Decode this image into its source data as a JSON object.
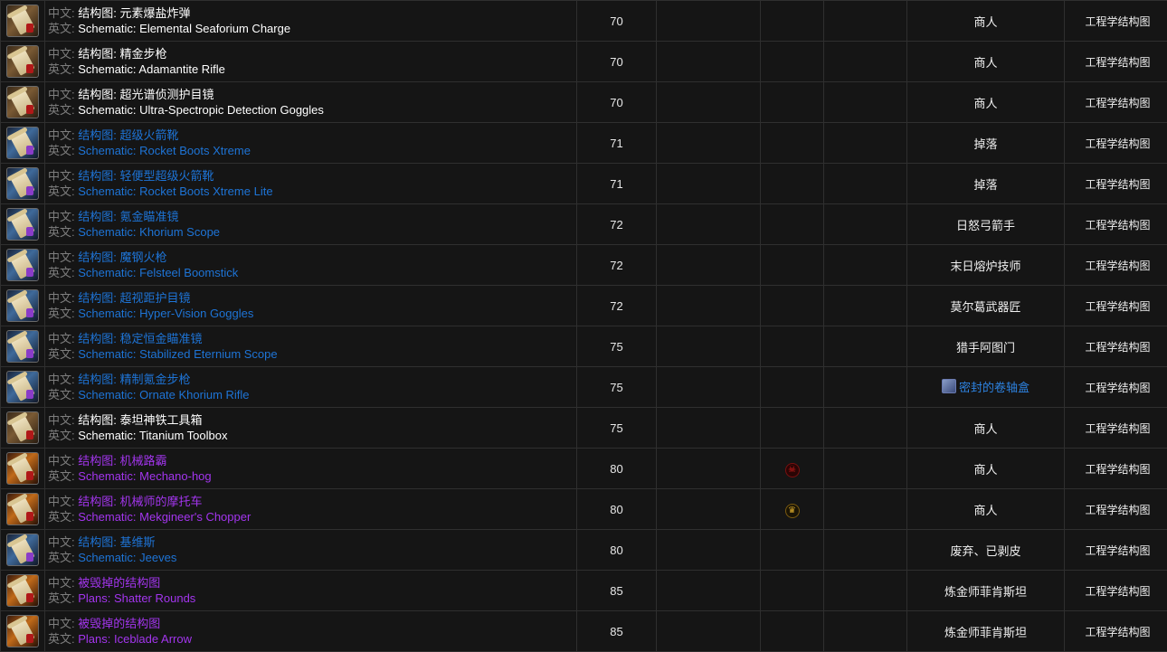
{
  "labels": {
    "zh": "中文: ",
    "en": "英文: "
  },
  "rows": [
    {
      "zh": "结构图: 元素爆盐炸弹",
      "en": "Schematic: Elemental Seaforium Charge",
      "level": "70",
      "faction": "",
      "source": "商人",
      "source_link": false,
      "category": "工程学结构图",
      "quality": "common",
      "icon": "schematic-scroll-icon"
    },
    {
      "zh": "结构图: 精金步枪",
      "en": "Schematic: Adamantite Rifle",
      "level": "70",
      "faction": "",
      "source": "商人",
      "source_link": false,
      "category": "工程学结构图",
      "quality": "common",
      "icon": "schematic-scroll-icon"
    },
    {
      "zh": "结构图: 超光谱侦测护目镜",
      "en": "Schematic: Ultra-Spectropic Detection Goggles",
      "level": "70",
      "faction": "",
      "source": "商人",
      "source_link": false,
      "category": "工程学结构图",
      "quality": "common",
      "icon": "schematic-scroll-icon"
    },
    {
      "zh": "结构图: 超级火箭靴",
      "en": "Schematic: Rocket Boots Xtreme",
      "level": "71",
      "faction": "",
      "source": "掉落",
      "source_link": false,
      "category": "工程学结构图",
      "quality": "rare",
      "icon": "schematic-scroll-icon"
    },
    {
      "zh": "结构图: 轻便型超级火箭靴",
      "en": "Schematic: Rocket Boots Xtreme Lite",
      "level": "71",
      "faction": "",
      "source": "掉落",
      "source_link": false,
      "category": "工程学结构图",
      "quality": "rare",
      "icon": "schematic-scroll-icon"
    },
    {
      "zh": "结构图: 氪金瞄准镜",
      "en": "Schematic: Khorium Scope",
      "level": "72",
      "faction": "",
      "source": "日怒弓箭手",
      "source_link": false,
      "category": "工程学结构图",
      "quality": "rare",
      "icon": "schematic-scroll-icon"
    },
    {
      "zh": "结构图: 魔钢火枪",
      "en": "Schematic: Felsteel Boomstick",
      "level": "72",
      "faction": "",
      "source": "末日熔炉技师",
      "source_link": false,
      "category": "工程学结构图",
      "quality": "rare",
      "icon": "schematic-scroll-icon"
    },
    {
      "zh": "结构图: 超视距护目镜",
      "en": "Schematic: Hyper-Vision Goggles",
      "level": "72",
      "faction": "",
      "source": "莫尔葛武器匠",
      "source_link": false,
      "category": "工程学结构图",
      "quality": "rare",
      "icon": "schematic-scroll-icon"
    },
    {
      "zh": "结构图: 稳定恒金瞄准镜",
      "en": "Schematic: Stabilized Eternium Scope",
      "level": "75",
      "faction": "",
      "source": "猎手阿图门",
      "source_link": false,
      "category": "工程学结构图",
      "quality": "rare",
      "icon": "schematic-scroll-icon"
    },
    {
      "zh": "结构图: 精制氪金步枪",
      "en": "Schematic: Ornate Khorium Rifle",
      "level": "75",
      "faction": "",
      "source": "密封的卷轴盒",
      "source_link": true,
      "category": "工程学结构图",
      "quality": "rare",
      "icon": "schematic-scroll-icon"
    },
    {
      "zh": "结构图: 泰坦神铁工具箱",
      "en": "Schematic: Titanium Toolbox",
      "level": "75",
      "faction": "",
      "source": "商人",
      "source_link": false,
      "category": "工程学结构图",
      "quality": "common",
      "icon": "schematic-scroll-icon"
    },
    {
      "zh": "结构图: 机械路霸",
      "en": "Schematic: Mechano-hog",
      "level": "80",
      "faction": "horde",
      "source": "商人",
      "source_link": false,
      "category": "工程学结构图",
      "quality": "epic",
      "icon": "schematic-scroll-icon"
    },
    {
      "zh": "结构图: 机械师的摩托车",
      "en": "Schematic: Mekgineer's Chopper",
      "level": "80",
      "faction": "alliance",
      "source": "商人",
      "source_link": false,
      "category": "工程学结构图",
      "quality": "epic",
      "icon": "schematic-scroll-icon"
    },
    {
      "zh": "结构图: 基维斯",
      "en": "Schematic: Jeeves",
      "level": "80",
      "faction": "",
      "source": "废弃、已剥皮",
      "source_link": false,
      "category": "工程学结构图",
      "quality": "rare",
      "icon": "schematic-scroll-icon"
    },
    {
      "zh": "被毁掉的结构图",
      "en": "Plans: Shatter Rounds",
      "level": "85",
      "faction": "",
      "source": "炼金师菲肯斯坦",
      "source_link": false,
      "category": "工程学结构图",
      "quality": "epic",
      "icon": "schematic-scroll-icon"
    },
    {
      "zh": "被毁掉的结构图",
      "en": "Plans: Iceblade Arrow",
      "level": "85",
      "faction": "",
      "source": "炼金师菲肯斯坦",
      "source_link": false,
      "category": "工程学结构图",
      "quality": "epic",
      "icon": "schematic-scroll-icon"
    }
  ],
  "colors": {
    "common": "#ffffff",
    "rare": "#1e74d6",
    "epic": "#a335ee",
    "label": "#7d7d7d",
    "link": "#2d82e0",
    "horde": "#e0201e",
    "alliance": "#d4a52a"
  }
}
